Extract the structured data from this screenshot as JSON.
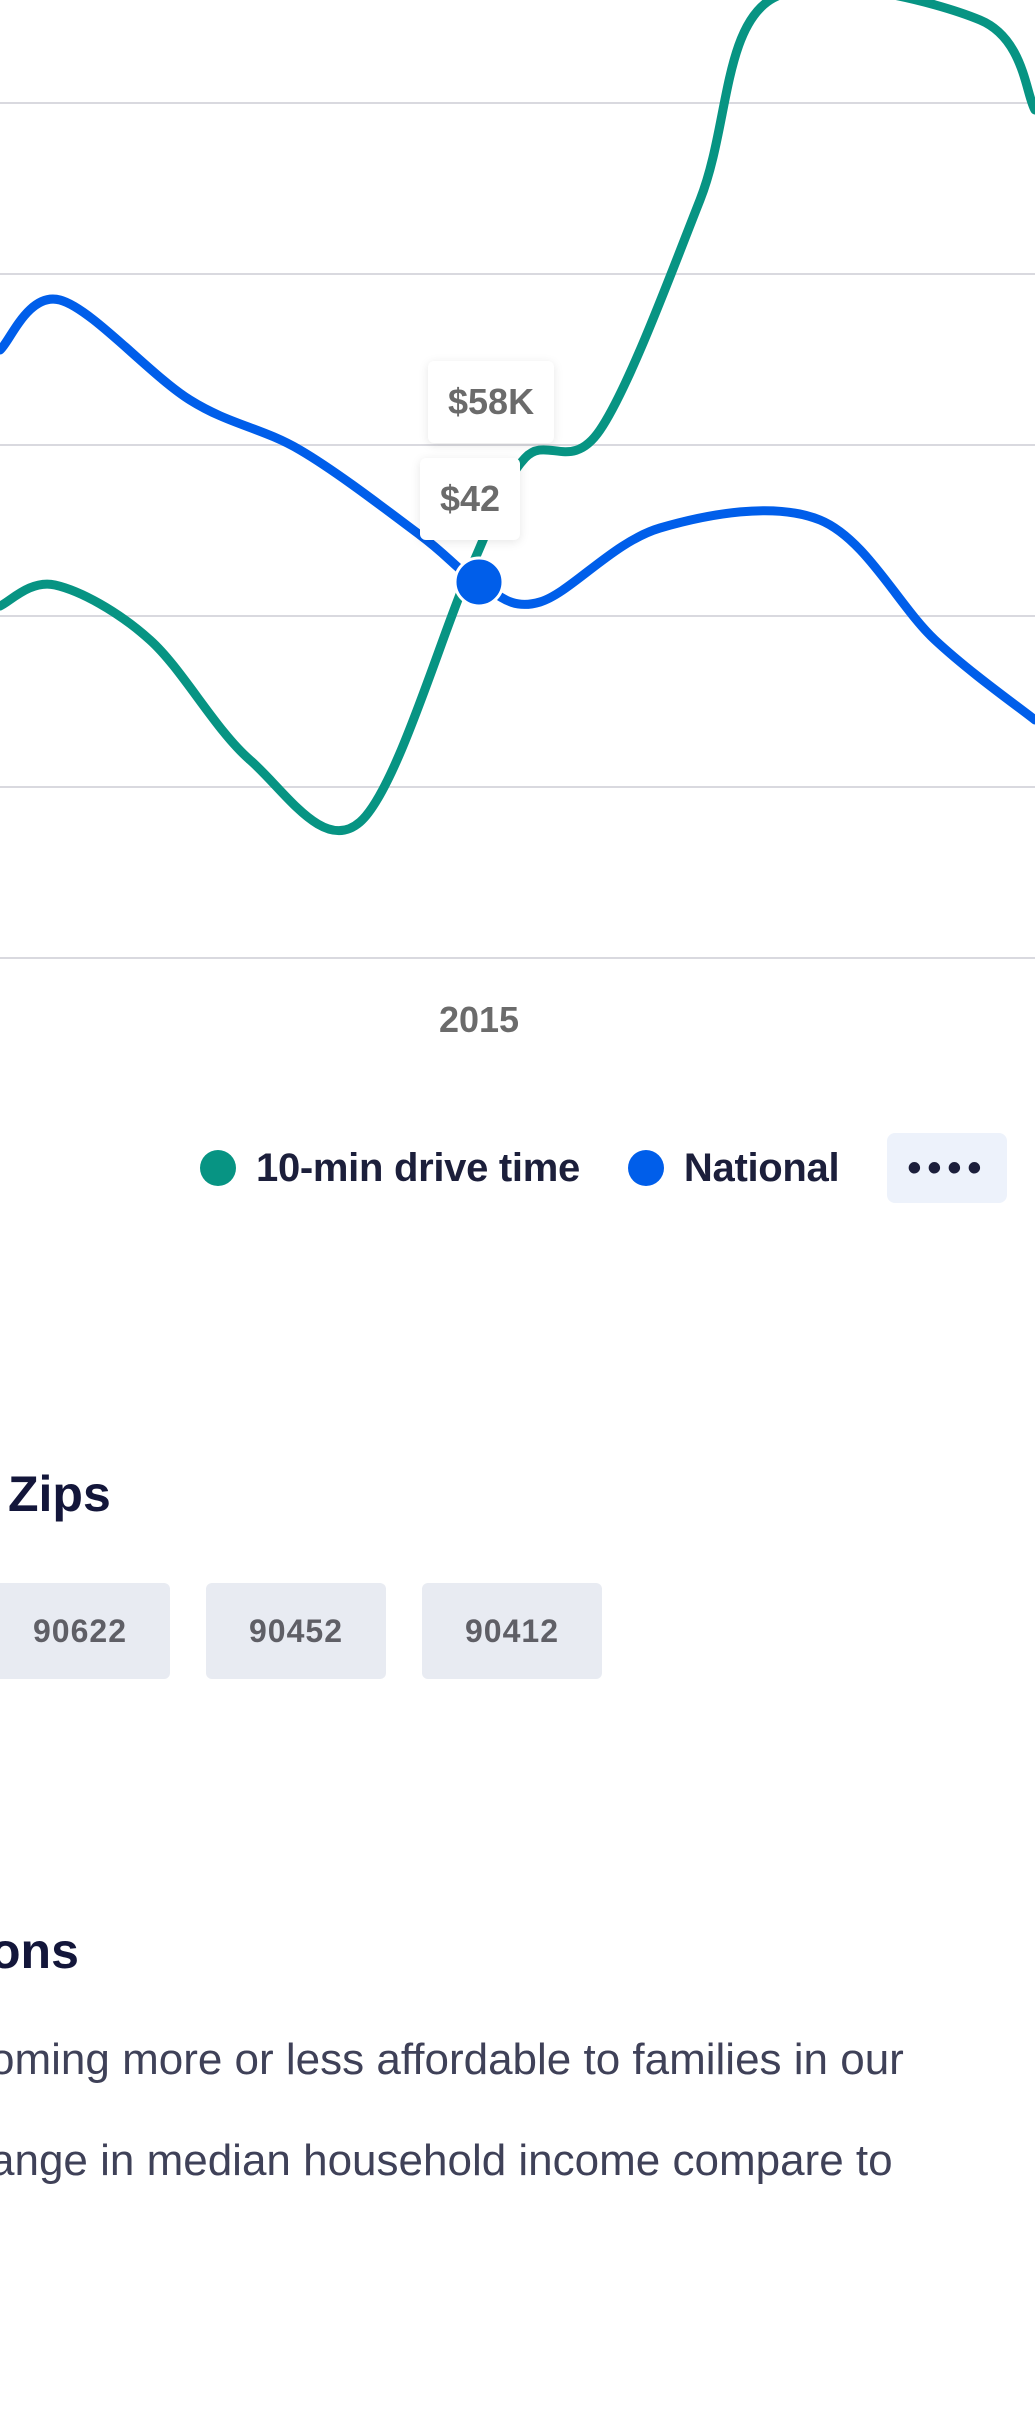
{
  "chart_data": {
    "type": "line",
    "xlabel": "",
    "ylabel": "",
    "x_tick_labels": [
      "2015"
    ],
    "grid": true,
    "series": [
      {
        "name": "10-min drive time",
        "color": "#079483",
        "values": [
          40,
          41,
          37,
          29,
          27,
          46,
          54,
          72,
          90,
          92,
          80
        ]
      },
      {
        "name": "National",
        "color": "#005eea",
        "values": [
          63,
          65,
          57,
          53,
          45,
          43,
          50,
          50,
          42,
          35
        ]
      }
    ],
    "highlight": {
      "x_label": "2015",
      "tooltip_top": "$58K",
      "tooltip_bottom": "$42"
    }
  },
  "legend": {
    "items": [
      {
        "label": "10-min drive time",
        "color": "#079483"
      },
      {
        "label": "National",
        "color": "#005eea"
      }
    ],
    "more_label": "••••"
  },
  "zips": {
    "heading": "Zips",
    "chips": [
      "90622",
      "90452",
      "90412"
    ]
  },
  "section": {
    "heading": "ons",
    "lines": [
      "oming more or less affordable to families in our",
      "ange in median household income compare to"
    ]
  }
}
